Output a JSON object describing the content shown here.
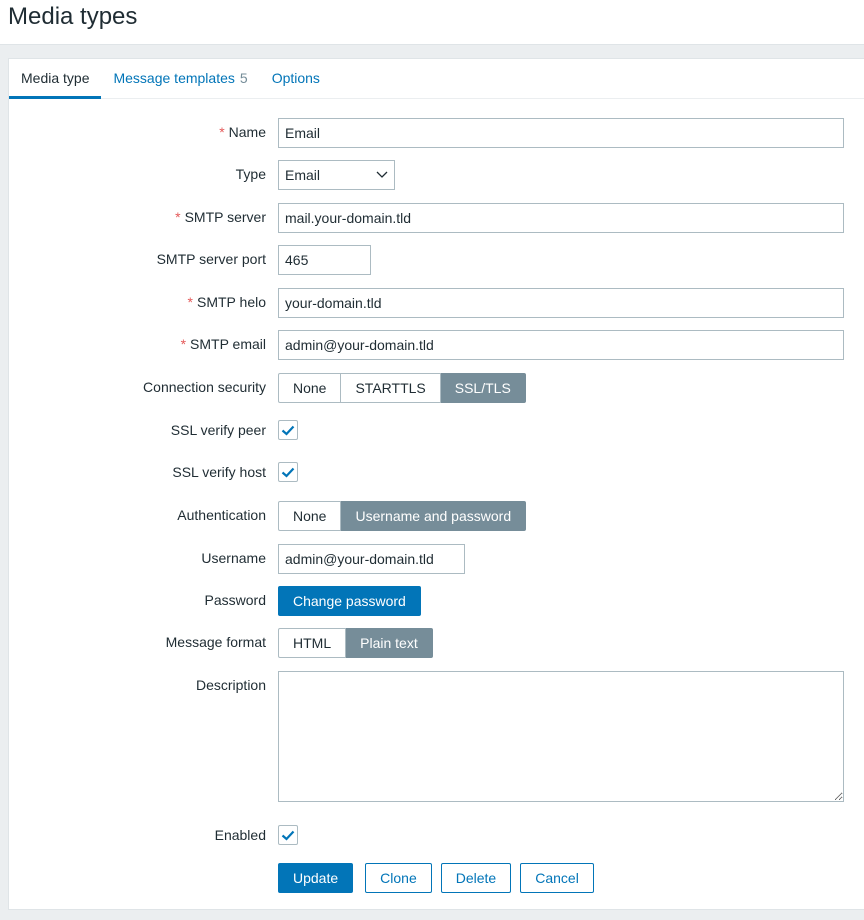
{
  "header": {
    "title": "Media types"
  },
  "tabs": [
    {
      "label": "Media type",
      "active": true
    },
    {
      "label": "Message templates",
      "count": "5"
    },
    {
      "label": "Options"
    }
  ],
  "form": {
    "name": {
      "label": "Name",
      "required": "*",
      "value": "Email"
    },
    "type": {
      "label": "Type",
      "value": "Email"
    },
    "smtp_server": {
      "label": "SMTP server",
      "required": "*",
      "value": "mail.your-domain.tld"
    },
    "smtp_port": {
      "label": "SMTP server port",
      "value": "465"
    },
    "smtp_helo": {
      "label": "SMTP helo",
      "required": "*",
      "value": "your-domain.tld"
    },
    "smtp_email": {
      "label": "SMTP email",
      "required": "*",
      "value": "admin@your-domain.tld"
    },
    "connection_security": {
      "label": "Connection security",
      "options": [
        "None",
        "STARTTLS",
        "SSL/TLS"
      ],
      "selected": "SSL/TLS"
    },
    "ssl_verify_peer": {
      "label": "SSL verify peer",
      "checked": true
    },
    "ssl_verify_host": {
      "label": "SSL verify host",
      "checked": true
    },
    "authentication": {
      "label": "Authentication",
      "options": [
        "None",
        "Username and password"
      ],
      "selected": "Username and password"
    },
    "username": {
      "label": "Username",
      "value": "admin@your-domain.tld"
    },
    "password": {
      "label": "Password",
      "button": "Change password"
    },
    "message_format": {
      "label": "Message format",
      "options": [
        "HTML",
        "Plain text"
      ],
      "selected": "Plain text"
    },
    "description": {
      "label": "Description",
      "value": ""
    },
    "enabled": {
      "label": "Enabled",
      "checked": true
    }
  },
  "actions": {
    "update": "Update",
    "clone": "Clone",
    "delete": "Delete",
    "cancel": "Cancel"
  },
  "colors": {
    "accent": "#0275b8",
    "selected_segment": "#768d99",
    "required": "#e45959"
  }
}
